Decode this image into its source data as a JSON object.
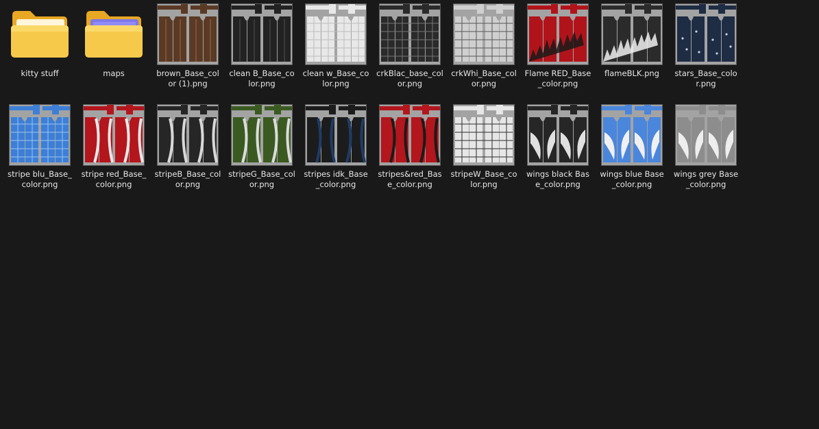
{
  "colors": {
    "background": "#191919",
    "label_text": "#e6e6e6",
    "folder_yellow": "#f7c94b",
    "folder_blue": "#8a84f0"
  },
  "items": [
    {
      "label": "kitty stuff",
      "kind": "folder",
      "variant": "yellow",
      "icon": "folder-icon"
    },
    {
      "label": "maps",
      "kind": "folder",
      "variant": "blue",
      "icon": "folder-icon"
    },
    {
      "label": "brown_Base_color (1).png",
      "kind": "image",
      "main": "#5a3a24",
      "accent": "#7a5238",
      "pattern": "plain"
    },
    {
      "label": "clean B_Base_color.png",
      "kind": "image",
      "main": "#222222",
      "accent": "#3a3a3a",
      "pattern": "plain"
    },
    {
      "label": "clean w_Base_color.png",
      "kind": "image",
      "main": "#e8e8e8",
      "accent": "#bdbdbd",
      "pattern": "grid"
    },
    {
      "label": "crkBlac_base_color.png",
      "kind": "image",
      "main": "#2a2a2a",
      "accent": "#777777",
      "pattern": "grid"
    },
    {
      "label": "crkWhi_Base_color.png",
      "kind": "image",
      "main": "#cfcfcf",
      "accent": "#555555",
      "pattern": "grid"
    },
    {
      "label": "Flame RED_Base_color.png",
      "kind": "image",
      "main": "#b0141a",
      "accent": "#1a1a1a",
      "pattern": "flame"
    },
    {
      "label": "flameBLK.png",
      "kind": "image",
      "main": "#2b2b2b",
      "accent": "#f0f0f0",
      "pattern": "flame"
    },
    {
      "label": "stars_Base_color.png",
      "kind": "image",
      "main": "#1e2c44",
      "accent": "#c8d0dc",
      "pattern": "stars"
    },
    {
      "label": "stripe blu_Base_color.png",
      "kind": "image",
      "main": "#3d7fd6",
      "accent": "#9cc6f2",
      "pattern": "grid"
    },
    {
      "label": "stripe red_Base_color.png",
      "kind": "image",
      "main": "#b3161c",
      "accent": "#e8e8e8",
      "pattern": "stripe"
    },
    {
      "label": "stripeB_Base_color.png",
      "kind": "image",
      "main": "#262626",
      "accent": "#d8d8d8",
      "pattern": "stripe"
    },
    {
      "label": "stripeG_Base_color.png",
      "kind": "image",
      "main": "#3b5a22",
      "accent": "#dcdcdc",
      "pattern": "stripe"
    },
    {
      "label": "stripes idk_Base_color.png",
      "kind": "image",
      "main": "#1c1c1c",
      "accent": "#1e3c66",
      "pattern": "stripe"
    },
    {
      "label": "stripes&red_Base_color.png",
      "kind": "image",
      "main": "#b3161c",
      "accent": "#1a1a1a",
      "pattern": "stripe"
    },
    {
      "label": "stripeW_Base_color.png",
      "kind": "image",
      "main": "#e6e6e6",
      "accent": "#2a2a2a",
      "pattern": "grid"
    },
    {
      "label": "wings black Base_color.png",
      "kind": "image",
      "main": "#262626",
      "accent": "#e0e0e0",
      "pattern": "wings"
    },
    {
      "label": "wings blue Base_color.png",
      "kind": "image",
      "main": "#4a86dc",
      "accent": "#f0f0f0",
      "pattern": "wings"
    },
    {
      "label": "wings grey Base_color.png",
      "kind": "image",
      "main": "#8d8d8d",
      "accent": "#eeeeee",
      "pattern": "wings"
    }
  ]
}
